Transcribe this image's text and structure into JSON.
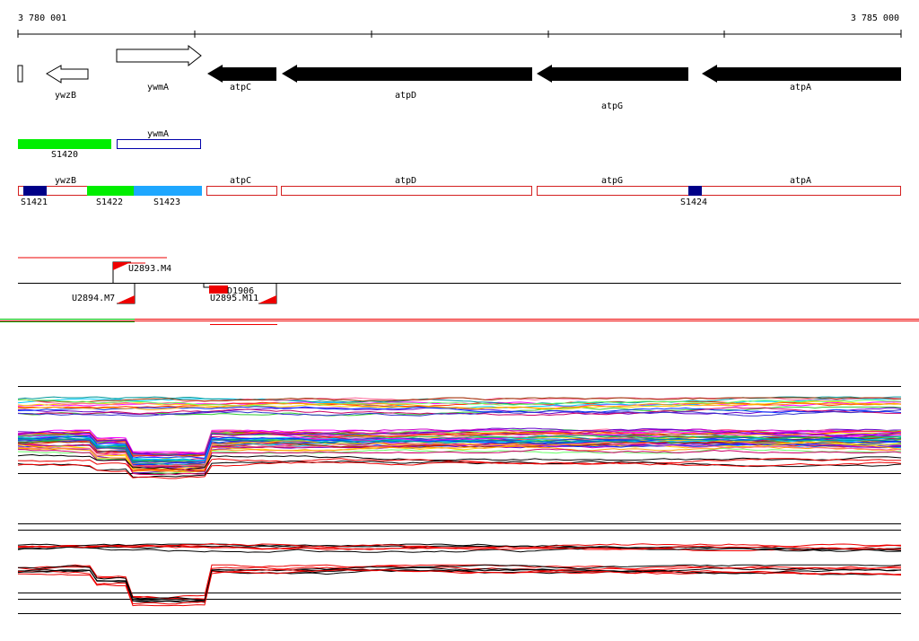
{
  "coordinates": {
    "start": "3 780 001",
    "end": "3 785 000"
  },
  "genes": {
    "ywzB": "ywzB",
    "ywmA": "ywmA",
    "atpC": "atpC",
    "atpD": "atpD",
    "atpG": "atpG",
    "atpA": "atpA"
  },
  "segments": {
    "S1420": "S1420",
    "S1421": "S1421",
    "S1422": "S1422",
    "S1423": "S1423",
    "S1424": "S1424"
  },
  "probes": {
    "U2893": "U2893.M4",
    "U2894": "U2894.M7",
    "U2895": "U2895.M11",
    "D1906": "D1906"
  },
  "colors": {
    "gene_forward": "#ffffff",
    "gene_reverse": "#000000",
    "segment_green": "#00ee00",
    "segment_blue": "#1ea7ff",
    "segment_navy": "#000088",
    "segment_outline": "#d42020",
    "probe_red": "#ee0000",
    "expr_black": "#000000",
    "expr_red": "#ee0000"
  }
}
